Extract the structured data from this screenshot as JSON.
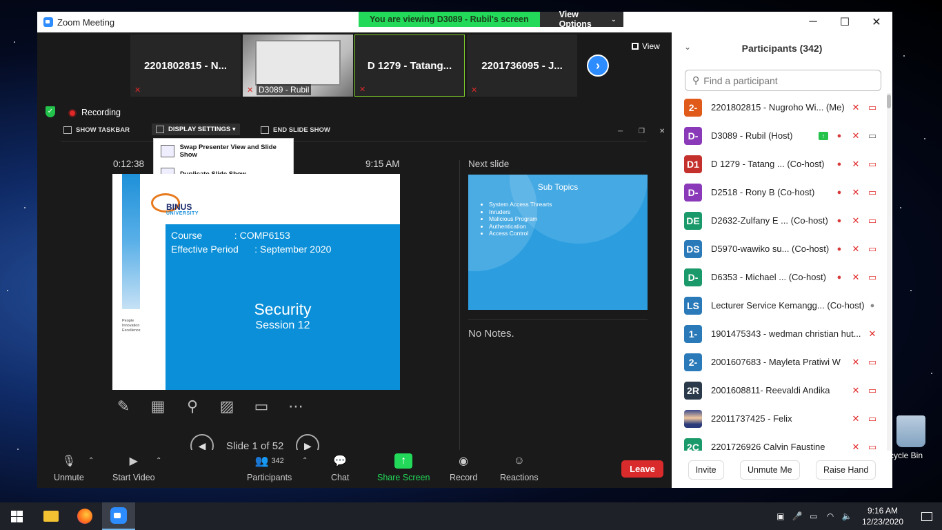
{
  "window": {
    "title": "Zoom Meeting"
  },
  "banner": {
    "viewing": "You are viewing D3089 - Rubil's screen",
    "view_options": "View Options"
  },
  "strip": {
    "thumbs": [
      {
        "label": "2201802815 - N..."
      },
      {
        "label": "D3089 - Rubil"
      },
      {
        "label": "D 1279 - Tatang..."
      },
      {
        "label": "2201736095 - J..."
      }
    ],
    "view_label": "View"
  },
  "share": {
    "recording": "Recording",
    "toolbar": {
      "show_taskbar": "SHOW TASKBAR",
      "display_settings": "DISPLAY SETTINGS ▾",
      "end_slide_show": "END SLIDE SHOW"
    },
    "dropdown": {
      "swap": "Swap Presenter View and Slide Show",
      "duplicate": "Duplicate Slide Show"
    },
    "timer": "0:12:38",
    "clock": "9:15 AM",
    "slide": {
      "logo": "BINUS",
      "logo_sub": "UNIVERSITY",
      "side_text": "People\nInnovation\nExcellence",
      "course_line": "Course            : COMP6153",
      "period_line": "Effective Period      : September 2020",
      "title": "Security",
      "subtitle": "Session  12"
    },
    "slide_counter": "Slide 1 of 52",
    "next_label": "Next slide",
    "next_slide": {
      "title": "Sub Topics",
      "items": [
        "System Access Threarts",
        "Inruders",
        "Malicious Program",
        "Authentication",
        "Access Control"
      ]
    },
    "notes": "No Notes."
  },
  "controls": {
    "unmute": "Unmute",
    "start_video": "Start Video",
    "participants": "Participants",
    "participants_count": "342",
    "chat": "Chat",
    "share_screen": "Share Screen",
    "record": "Record",
    "reactions": "Reactions",
    "leave": "Leave"
  },
  "panel": {
    "title": "Participants (342)",
    "search_placeholder": "Find a participant",
    "participants": [
      {
        "initials": "2-",
        "color": "#e05a1a",
        "name": "2201802815 - Nugroho Wi... (Me)",
        "icons": [
          "mic-off",
          "video-off"
        ]
      },
      {
        "initials": "D-",
        "color": "#8a3ab9",
        "name": "D3089 - Rubil (Host)",
        "icons": [
          "share",
          "record",
          "mic-off",
          "video"
        ]
      },
      {
        "initials": "D1",
        "color": "#c4302b",
        "name": "D 1279 - Tatang  ... (Co-host)",
        "icons": [
          "record",
          "mic-off",
          "video-off"
        ]
      },
      {
        "initials": "D-",
        "color": "#8a3ab9",
        "name": "D2518 - Rony B (Co-host)",
        "icons": [
          "record",
          "mic-off",
          "video-off"
        ]
      },
      {
        "initials": "DE",
        "color": "#1a9a6a",
        "name": "D2632-Zulfany E ... (Co-host)",
        "icons": [
          "record",
          "mic-off",
          "video-off"
        ]
      },
      {
        "initials": "DS",
        "color": "#2a7ab9",
        "name": "D5970-wawiko su... (Co-host)",
        "icons": [
          "record",
          "mic-off",
          "video-off"
        ]
      },
      {
        "initials": "D-",
        "color": "#1a9a6a",
        "name": "D6353 - Michael ... (Co-host)",
        "icons": [
          "record",
          "mic-off",
          "video-off"
        ]
      },
      {
        "initials": "LS",
        "color": "#2a7ab9",
        "name": "Lecturer Service Kemangg... (Co-host)",
        "icons": [
          "record-gray"
        ]
      },
      {
        "initials": "1-",
        "color": "#2a7ab9",
        "name": "1901475343 - wedman christian hut...",
        "icons": [
          "mic-off"
        ]
      },
      {
        "initials": "2-",
        "color": "#2a7ab9",
        "name": "2001607683 - Mayleta Pratiwi W",
        "icons": [
          "mic-off",
          "video-off"
        ]
      },
      {
        "initials": "2R",
        "color": "#2a3a4a",
        "name": "2001608811- Reevaldi Andika",
        "icons": [
          "mic-off",
          "video-off"
        ]
      },
      {
        "initials": "",
        "color": "photo",
        "name": "22011737425 - Felix",
        "icons": [
          "mic-off",
          "video-off"
        ]
      },
      {
        "initials": "2C",
        "color": "#1a9a6a",
        "name": "2201726926 Calvin Faustine",
        "icons": [
          "mic-off",
          "video-off"
        ]
      }
    ],
    "footer": {
      "invite": "Invite",
      "unmute_me": "Unmute Me",
      "raise_hand": "Raise Hand"
    }
  },
  "desktop": {
    "recycle_bin": "cycle Bin"
  },
  "taskbar": {
    "time": "9:16 AM",
    "date": "12/23/2020"
  }
}
